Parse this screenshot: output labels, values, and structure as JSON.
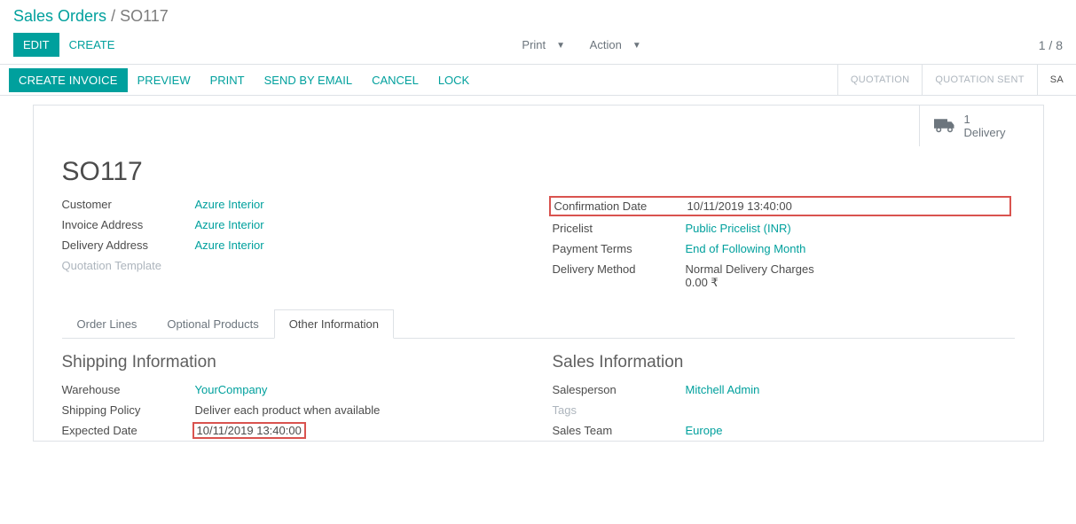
{
  "breadcrumb": {
    "root": "Sales Orders",
    "sep": "/",
    "current": "SO117"
  },
  "controls": {
    "edit": "EDIT",
    "create": "CREATE",
    "print": "Print",
    "action": "Action",
    "pager": "1 / 8"
  },
  "statusbar": {
    "create_invoice": "CREATE INVOICE",
    "preview": "PREVIEW",
    "print": "PRINT",
    "send_by_email": "SEND BY EMAIL",
    "cancel": "CANCEL",
    "lock": "LOCK",
    "stages": {
      "quotation": "QUOTATION",
      "quotation_sent": "QUOTATION SENT",
      "sale": "SA"
    }
  },
  "statbox": {
    "count": "1",
    "label": "Delivery"
  },
  "record": {
    "title": "SO117",
    "left": {
      "customer": {
        "label": "Customer",
        "value": "Azure Interior"
      },
      "invoice_address": {
        "label": "Invoice Address",
        "value": "Azure Interior"
      },
      "delivery_address": {
        "label": "Delivery Address",
        "value": "Azure Interior"
      },
      "quotation_template": {
        "label": "Quotation Template",
        "value": ""
      }
    },
    "right": {
      "confirmation_date": {
        "label": "Confirmation Date",
        "value": "10/11/2019 13:40:00"
      },
      "pricelist": {
        "label": "Pricelist",
        "value": "Public Pricelist (INR)"
      },
      "payment_terms": {
        "label": "Payment Terms",
        "value": "End of Following Month"
      },
      "delivery_method": {
        "label": "Delivery Method",
        "value": "Normal Delivery Charges",
        "extra": "0.00 ₹"
      }
    }
  },
  "tabs": {
    "order_lines": "Order Lines",
    "optional_products": "Optional Products",
    "other_info": "Other Information"
  },
  "shipping": {
    "heading": "Shipping Information",
    "warehouse": {
      "label": "Warehouse",
      "value": "YourCompany"
    },
    "shipping_policy": {
      "label": "Shipping Policy",
      "value": "Deliver each product when available"
    },
    "expected_date": {
      "label": "Expected Date",
      "value": "10/11/2019 13:40:00"
    }
  },
  "sales": {
    "heading": "Sales Information",
    "salesperson": {
      "label": "Salesperson",
      "value": "Mitchell Admin"
    },
    "tags": {
      "label": "Tags",
      "value": ""
    },
    "sales_team": {
      "label": "Sales Team",
      "value": "Europe"
    }
  }
}
